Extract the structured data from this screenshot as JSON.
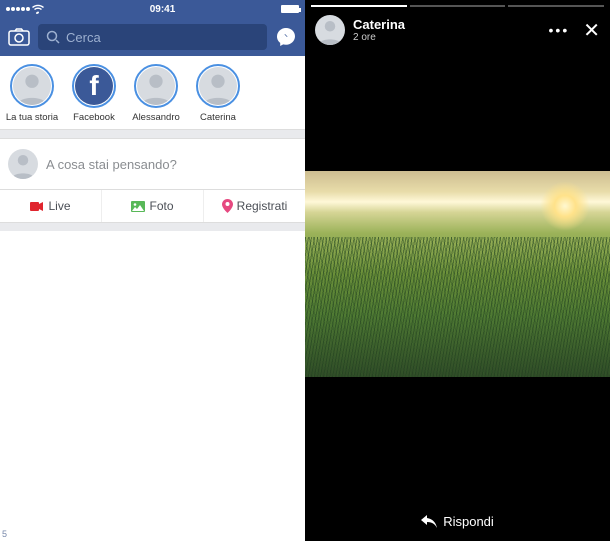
{
  "status": {
    "time": "09:41"
  },
  "search": {
    "placeholder": "Cerca"
  },
  "stories": [
    {
      "label": "La tua storia"
    },
    {
      "label": "Facebook"
    },
    {
      "label": "Alessandro"
    },
    {
      "label": "Caterina"
    }
  ],
  "composer": {
    "placeholder": "A cosa stai pensando?"
  },
  "actions": {
    "live": "Live",
    "foto": "Foto",
    "registrati": "Registrati"
  },
  "viewer": {
    "name": "Caterina",
    "time": "2 ore",
    "reply": "Rispondi"
  },
  "corner": "5"
}
